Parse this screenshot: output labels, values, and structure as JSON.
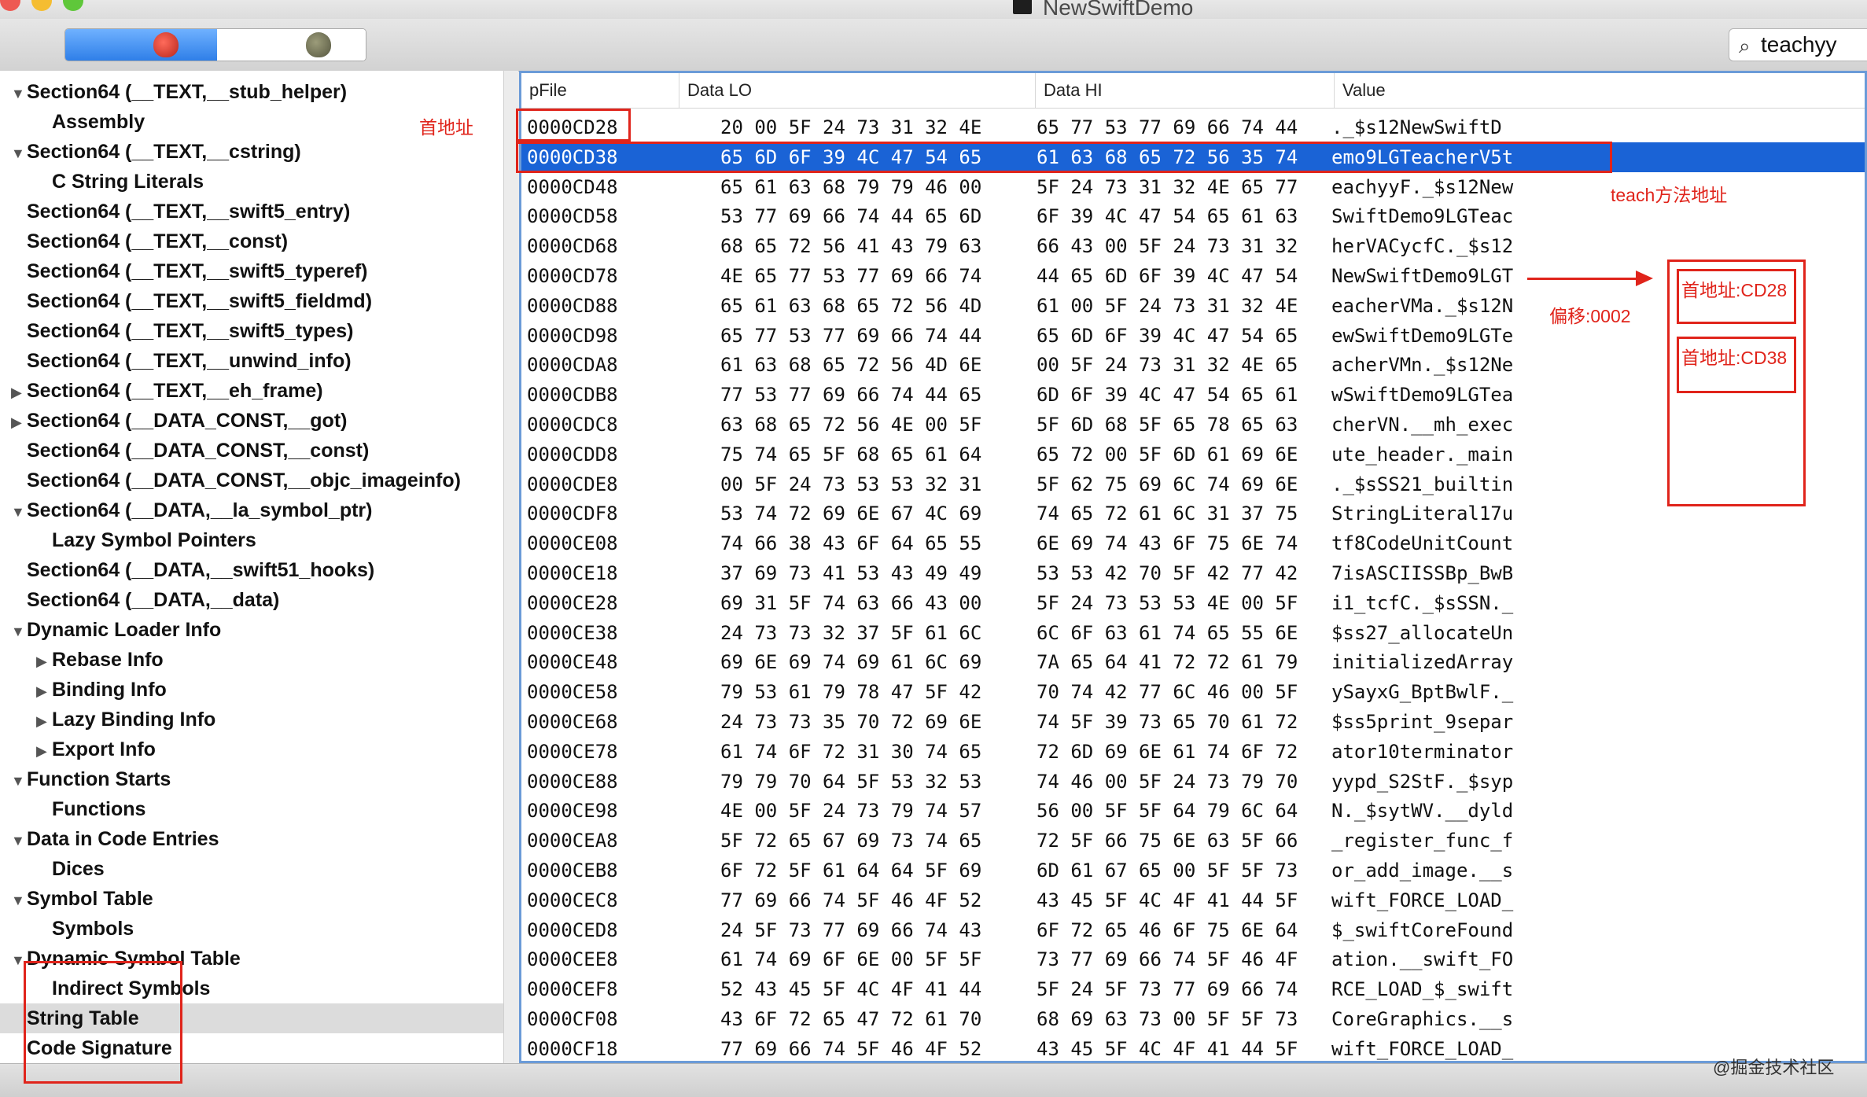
{
  "window": {
    "title": "NewSwiftDemo"
  },
  "toolbar": {
    "search_value": "teachyy"
  },
  "sidebar": {
    "items": [
      {
        "label": "Section64 (__TEXT,__stub_helper)",
        "tri": "▼",
        "indent": 0
      },
      {
        "label": "Assembly",
        "tri": "",
        "indent": 1
      },
      {
        "label": "Section64 (__TEXT,__cstring)",
        "tri": "▼",
        "indent": 0
      },
      {
        "label": "C String Literals",
        "tri": "",
        "indent": 1
      },
      {
        "label": "Section64 (__TEXT,__swift5_entry)",
        "tri": "",
        "indent": 0
      },
      {
        "label": "Section64 (__TEXT,__const)",
        "tri": "",
        "indent": 0
      },
      {
        "label": "Section64 (__TEXT,__swift5_typeref)",
        "tri": "",
        "indent": 0
      },
      {
        "label": "Section64 (__TEXT,__swift5_fieldmd)",
        "tri": "",
        "indent": 0
      },
      {
        "label": "Section64 (__TEXT,__swift5_types)",
        "tri": "",
        "indent": 0
      },
      {
        "label": "Section64 (__TEXT,__unwind_info)",
        "tri": "",
        "indent": 0
      },
      {
        "label": "Section64 (__TEXT,__eh_frame)",
        "tri": "▶",
        "indent": 0
      },
      {
        "label": "Section64 (__DATA_CONST,__got)",
        "tri": "▶",
        "indent": 0
      },
      {
        "label": "Section64 (__DATA_CONST,__const)",
        "tri": "",
        "indent": 0
      },
      {
        "label": "Section64 (__DATA_CONST,__objc_imageinfo)",
        "tri": "",
        "indent": 0
      },
      {
        "label": "Section64 (__DATA,__la_symbol_ptr)",
        "tri": "▼",
        "indent": 0
      },
      {
        "label": "Lazy Symbol Pointers",
        "tri": "",
        "indent": 1
      },
      {
        "label": "Section64 (__DATA,__swift51_hooks)",
        "tri": "",
        "indent": 0
      },
      {
        "label": "Section64 (__DATA,__data)",
        "tri": "",
        "indent": 0
      },
      {
        "label": "Dynamic Loader Info",
        "tri": "▼",
        "indent": 0
      },
      {
        "label": "Rebase Info",
        "tri": "▶",
        "indent": 1
      },
      {
        "label": "Binding Info",
        "tri": "▶",
        "indent": 1
      },
      {
        "label": "Lazy Binding Info",
        "tri": "▶",
        "indent": 1
      },
      {
        "label": "Export Info",
        "tri": "▶",
        "indent": 1
      },
      {
        "label": "Function Starts",
        "tri": "▼",
        "indent": 0
      },
      {
        "label": "Functions",
        "tri": "",
        "indent": 1
      },
      {
        "label": "Data in Code Entries",
        "tri": "▼",
        "indent": 0
      },
      {
        "label": "Dices",
        "tri": "",
        "indent": 1
      },
      {
        "label": "Symbol Table",
        "tri": "▼",
        "indent": 0
      },
      {
        "label": "Symbols",
        "tri": "",
        "indent": 1
      },
      {
        "label": "Dynamic Symbol Table",
        "tri": "▼",
        "indent": 0
      },
      {
        "label": "Indirect Symbols",
        "tri": "",
        "indent": 1
      },
      {
        "label": "String Table",
        "tri": "",
        "indent": 0,
        "selected": true
      },
      {
        "label": "Code Signature",
        "tri": "",
        "indent": 0
      }
    ]
  },
  "table": {
    "columns": [
      "pFile",
      "Data LO",
      "Data HI",
      "Value"
    ],
    "rows": [
      [
        "0000CD28",
        "20 00 5F 24 73 31 32 4E",
        "65 77 53 77 69 66 74 44",
        "._$s12NewSwiftD"
      ],
      [
        "0000CD38",
        "65 6D 6F 39 4C 47 54 65",
        "61 63 68 65 72 56 35 74",
        "emo9LGTeacherV5t"
      ],
      [
        "0000CD48",
        "65 61 63 68 79 79 46 00",
        "5F 24 73 31 32 4E 65 77",
        "eachyyF._$s12New"
      ],
      [
        "0000CD58",
        "53 77 69 66 74 44 65 6D",
        "6F 39 4C 47 54 65 61 63",
        "SwiftDemo9LGTeac"
      ],
      [
        "0000CD68",
        "68 65 72 56 41 43 79 63",
        "66 43 00 5F 24 73 31 32",
        "herVACycfC._$s12"
      ],
      [
        "0000CD78",
        "4E 65 77 53 77 69 66 74",
        "44 65 6D 6F 39 4C 47 54",
        "NewSwiftDemo9LGT"
      ],
      [
        "0000CD88",
        "65 61 63 68 65 72 56 4D",
        "61 00 5F 24 73 31 32 4E",
        "eacherVMa._$s12N"
      ],
      [
        "0000CD98",
        "65 77 53 77 69 66 74 44",
        "65 6D 6F 39 4C 47 54 65",
        "ewSwiftDemo9LGTe"
      ],
      [
        "0000CDA8",
        "61 63 68 65 72 56 4D 6E",
        "00 5F 24 73 31 32 4E 65",
        "acherVMn._$s12Ne"
      ],
      [
        "0000CDB8",
        "77 53 77 69 66 74 44 65",
        "6D 6F 39 4C 47 54 65 61",
        "wSwiftDemo9LGTea"
      ],
      [
        "0000CDC8",
        "63 68 65 72 56 4E 00 5F",
        "5F 6D 68 5F 65 78 65 63",
        "cherVN.__mh_exec"
      ],
      [
        "0000CDD8",
        "75 74 65 5F 68 65 61 64",
        "65 72 00 5F 6D 61 69 6E",
        "ute_header._main"
      ],
      [
        "0000CDE8",
        "00 5F 24 73 53 53 32 31",
        "5F 62 75 69 6C 74 69 6E",
        "._$sSS21_builtin"
      ],
      [
        "0000CDF8",
        "53 74 72 69 6E 67 4C 69",
        "74 65 72 61 6C 31 37 75",
        "StringLiteral17u"
      ],
      [
        "0000CE08",
        "74 66 38 43 6F 64 65 55",
        "6E 69 74 43 6F 75 6E 74",
        "tf8CodeUnitCount"
      ],
      [
        "0000CE18",
        "37 69 73 41 53 43 49 49",
        "53 53 42 70 5F 42 77 42",
        "7isASCIISSBp_BwB"
      ],
      [
        "0000CE28",
        "69 31 5F 74 63 66 43 00",
        "5F 24 73 53 53 4E 00 5F",
        "i1_tcfC._$sSSN._"
      ],
      [
        "0000CE38",
        "24 73 73 32 37 5F 61 6C",
        "6C 6F 63 61 74 65 55 6E",
        "$ss27_allocateUn"
      ],
      [
        "0000CE48",
        "69 6E 69 74 69 61 6C 69",
        "7A 65 64 41 72 72 61 79",
        "initializedArray"
      ],
      [
        "0000CE58",
        "79 53 61 79 78 47 5F 42",
        "70 74 42 77 6C 46 00 5F",
        "ySayxG_BptBwlF._"
      ],
      [
        "0000CE68",
        "24 73 73 35 70 72 69 6E",
        "74 5F 39 73 65 70 61 72",
        "$ss5print_9separ"
      ],
      [
        "0000CE78",
        "61 74 6F 72 31 30 74 65",
        "72 6D 69 6E 61 74 6F 72",
        "ator10terminator"
      ],
      [
        "0000CE88",
        "79 79 70 64 5F 53 32 53",
        "74 46 00 5F 24 73 79 70",
        "yypd_S2StF._$syp"
      ],
      [
        "0000CE98",
        "4E 00 5F 24 73 79 74 57",
        "56 00 5F 5F 64 79 6C 64",
        "N._$sytWV.__dyld"
      ],
      [
        "0000CEA8",
        "5F 72 65 67 69 73 74 65",
        "72 5F 66 75 6E 63 5F 66",
        "_register_func_f"
      ],
      [
        "0000CEB8",
        "6F 72 5F 61 64 64 5F 69",
        "6D 61 67 65 00 5F 5F 73",
        "or_add_image.__s"
      ],
      [
        "0000CEC8",
        "77 69 66 74 5F 46 4F 52",
        "43 45 5F 4C 4F 41 44 5F",
        "wift_FORCE_LOAD_"
      ],
      [
        "0000CED8",
        "24 5F 73 77 69 66 74 43",
        "6F 72 65 46 6F 75 6E 64",
        "$_swiftCoreFound"
      ],
      [
        "0000CEE8",
        "61 74 69 6F 6E 00 5F 5F",
        "73 77 69 66 74 5F 46 4F",
        "ation.__swift_FO"
      ],
      [
        "0000CEF8",
        "52 43 45 5F 4C 4F 41 44",
        "5F 24 5F 73 77 69 66 74",
        "RCE_LOAD_$_swift"
      ],
      [
        "0000CF08",
        "43 6F 72 65 47 72 61 70",
        "68 69 63 73 00 5F 5F 73",
        "CoreGraphics.__s"
      ],
      [
        "0000CF18",
        "77 69 66 74 5F 46 4F 52",
        "43 45 5F 4C 4F 41 44 5F",
        "wift_FORCE_LOAD_"
      ]
    ],
    "selected_row": 1
  },
  "annotations": {
    "first_address": "首地址",
    "teach_method_address": "teach方法地址",
    "offset": "偏移:0002",
    "box_addr_1": "首地址:CD28",
    "box_addr_2": "首地址:CD38"
  },
  "watermark": "@掘金技术社区",
  "colors": {
    "selection": "#1a63d6",
    "annotation_red": "#e0241b",
    "table_border": "#6b9bd8"
  }
}
